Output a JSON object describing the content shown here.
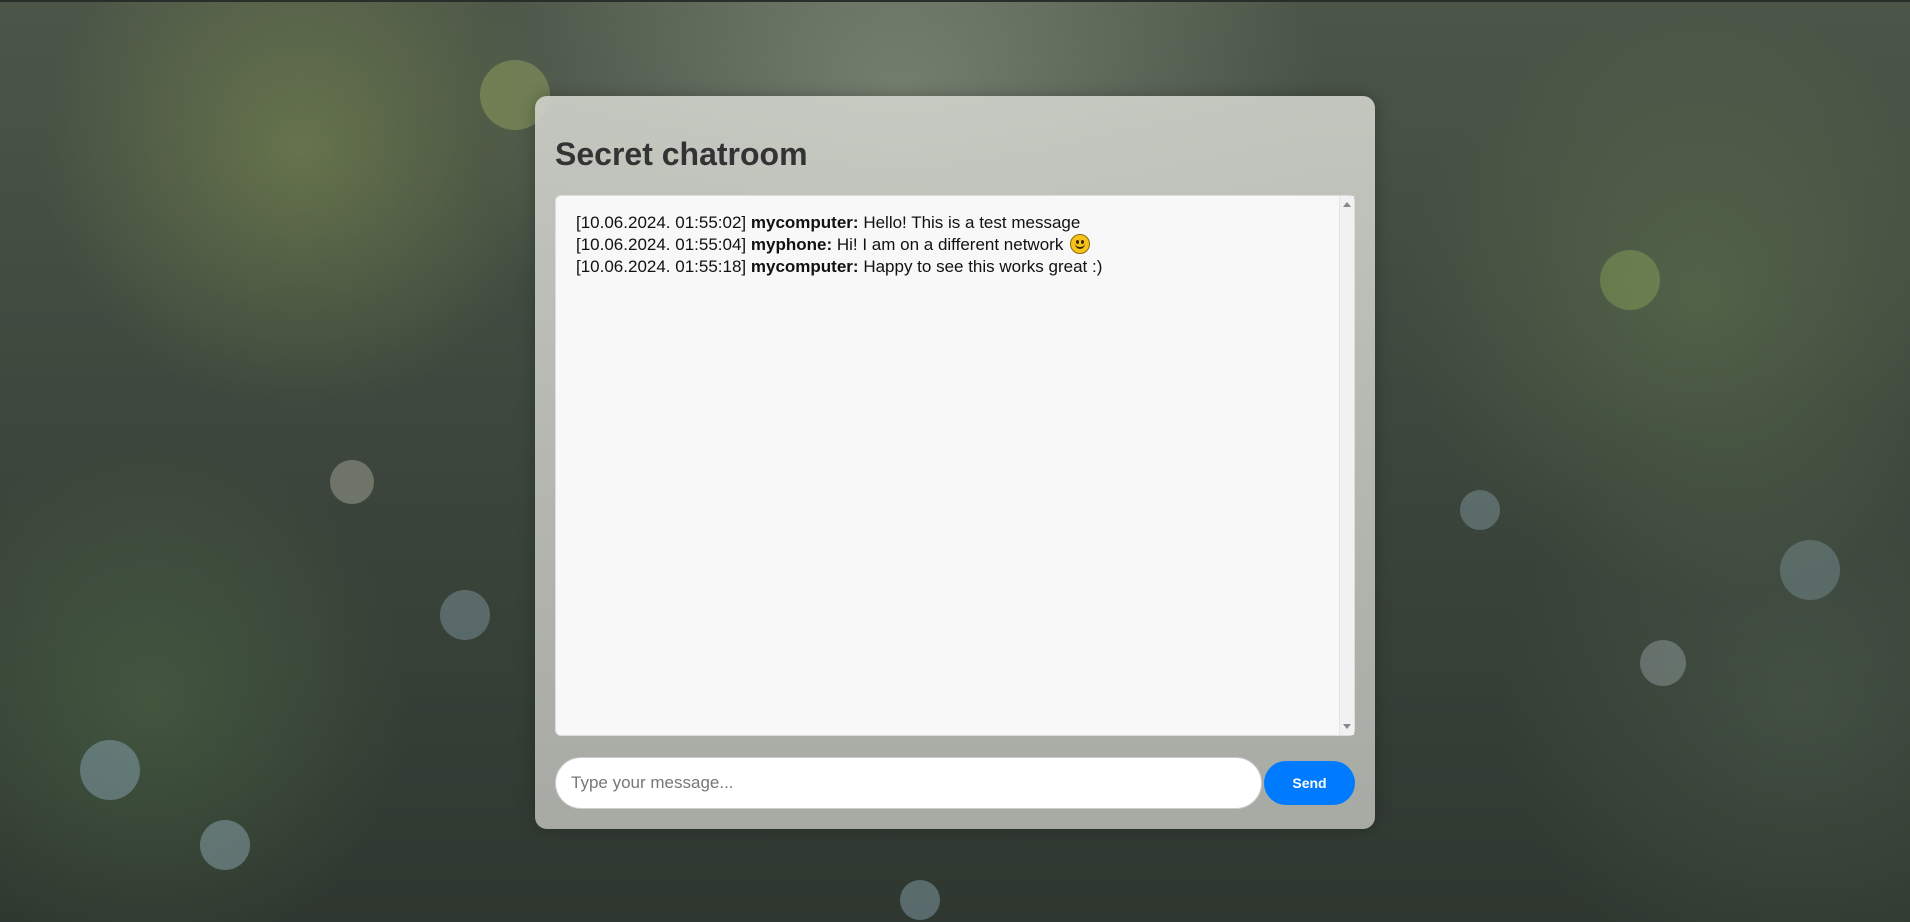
{
  "chat": {
    "title": "Secret chatroom",
    "messages": [
      {
        "timestamp": "[10.06.2024. 01:55:02]",
        "user": "mycomputer:",
        "text": "Hello! This is a test message",
        "emoji": false
      },
      {
        "timestamp": "[10.06.2024. 01:55:04]",
        "user": "myphone:",
        "text": "Hi! I am on a different network",
        "emoji": true
      },
      {
        "timestamp": "[10.06.2024. 01:55:18]",
        "user": "mycomputer:",
        "text": "Happy to see this works great :)",
        "emoji": false
      }
    ]
  },
  "composer": {
    "placeholder": "Type your message...",
    "send_label": "Send"
  },
  "colors": {
    "send_button": "#007bff",
    "emoji": "#f7c21c"
  },
  "icons": {
    "emoji": "slightly-smiling-face-icon"
  }
}
